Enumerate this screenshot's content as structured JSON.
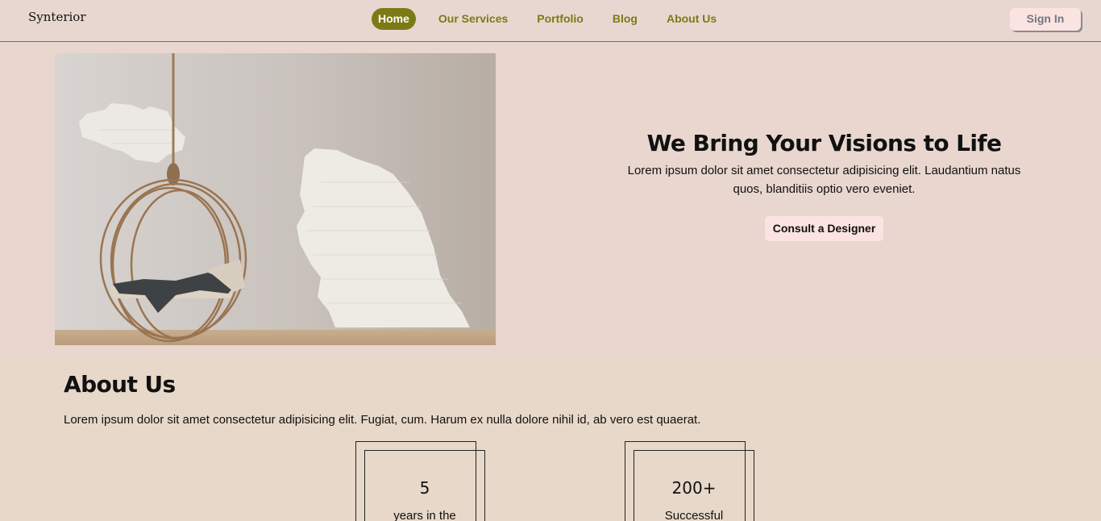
{
  "header": {
    "logo": "Synterior",
    "nav": [
      "Home",
      "Our Services",
      "Portfolio",
      "Blog",
      "About Us"
    ],
    "active_nav": "Home",
    "sign_in": "Sign In"
  },
  "hero": {
    "title": "We Bring Your Visions to Life",
    "description": "Lorem ipsum dolor sit amet consectetur adipisicing elit. Laudantium natus quos, blanditiis optio vero eveniet.",
    "cta": "Consult a Designer"
  },
  "about": {
    "title": "About Us",
    "description": "Lorem ipsum dolor sit amet consectetur adipisicing elit. Fugiat, cum. Harum ex nulla dolore nihil id, ab vero est quaerat.",
    "stats": [
      {
        "value": "5",
        "label": "years in the"
      },
      {
        "value": "200+",
        "label": "Successful"
      }
    ]
  },
  "colors": {
    "accent": "#7c7a16",
    "header_bg": "#e8d7d0",
    "about_bg": "#e8d8c9",
    "button_pink": "#fbe3e2"
  }
}
